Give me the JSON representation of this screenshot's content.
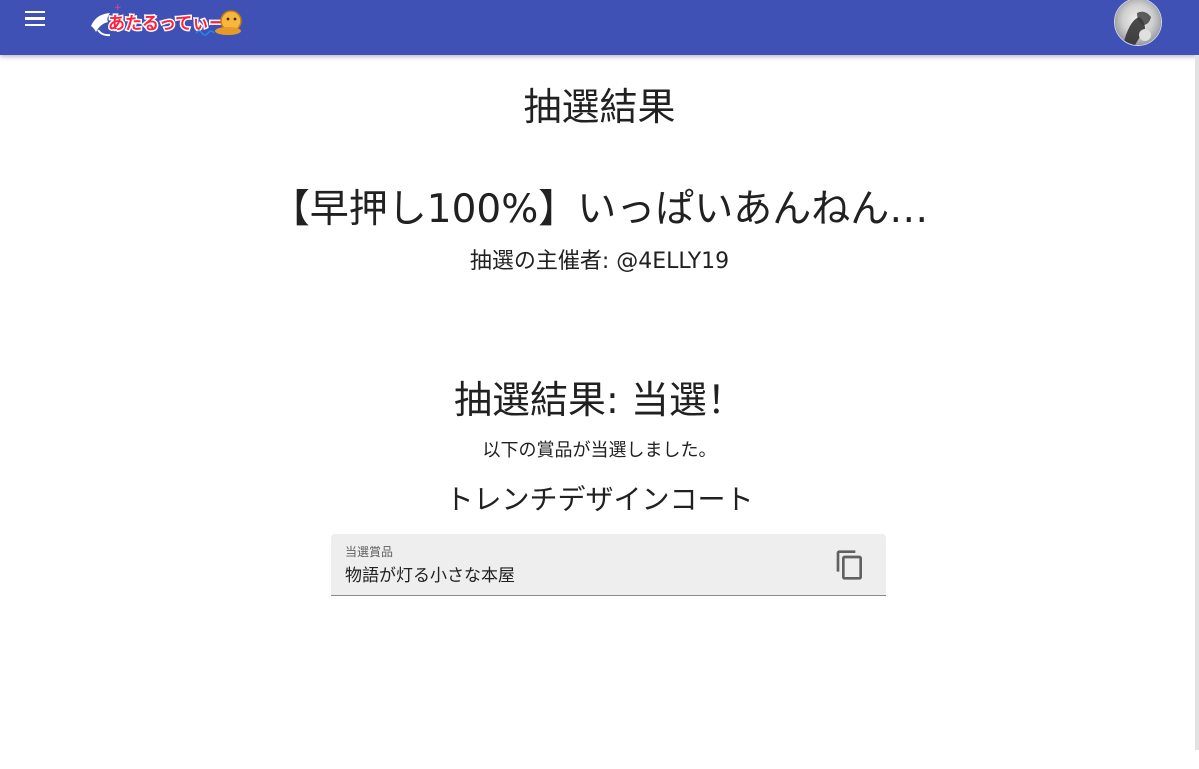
{
  "header": {
    "logo_text": "あたるってぃー",
    "menu_icon": "menu-icon",
    "avatar_icon": "user-avatar",
    "background_color": "#3f51b5"
  },
  "main": {
    "page_title": "抽選結果",
    "lottery_title": "【早押し100%】いっぱいあんねん…",
    "organizer": "抽選の主催者: @4ELLY19",
    "result_heading": "抽選結果: 当選！",
    "result_message": "以下の賞品が当選しました。",
    "prize_name": "トレンチデザインコート",
    "prize_field": {
      "label": "当選賞品",
      "value": "物語が灯る小さな本屋",
      "copy_icon": "copy-icon"
    }
  }
}
